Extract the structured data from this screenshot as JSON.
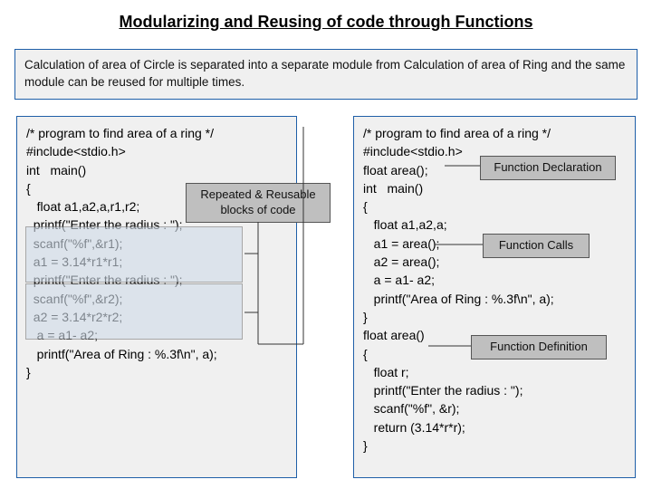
{
  "title": "Modularizing and Reusing of code through Functions",
  "intro": "Calculation of area of Circle is separated into a separate module from Calculation of area of Ring and the same module can be reused for multiple times.",
  "left_code": "/* program to find area of a ring */\n#include<stdio.h>\nint   main()\n{\n   float a1,a2,a,r1,r2;\n  printf(\"Enter the radius : \");\n  scanf(\"%f\",&r1);\n  a1 = 3.14*r1*r1;\n  printf(\"Enter the radius : \");\n  scanf(\"%f\",&r2);\n  a2 = 3.14*r2*r2;\n   a = a1- a2;\n   printf(\"Area of Ring : %.3f\\n\", a);\n}",
  "right_code": "/* program to find area of a ring */\n#include<stdio.h>\nfloat area();\nint   main()\n{\n   float a1,a2,a;\n   a1 = area();\n   a2 = area();\n   a = a1- a2;\n   printf(\"Area of Ring : %.3f\\n\", a);\n}\nfloat area()\n{\n   float r;\n   printf(\"Enter the radius : \");\n   scanf(\"%f\", &r);\n   return (3.14*r*r);\n}",
  "labels": {
    "repeat": "Repeated & Reusable blocks of code",
    "declaration": "Function Declaration",
    "calls": "Function Calls",
    "definition": "Function Definition"
  }
}
